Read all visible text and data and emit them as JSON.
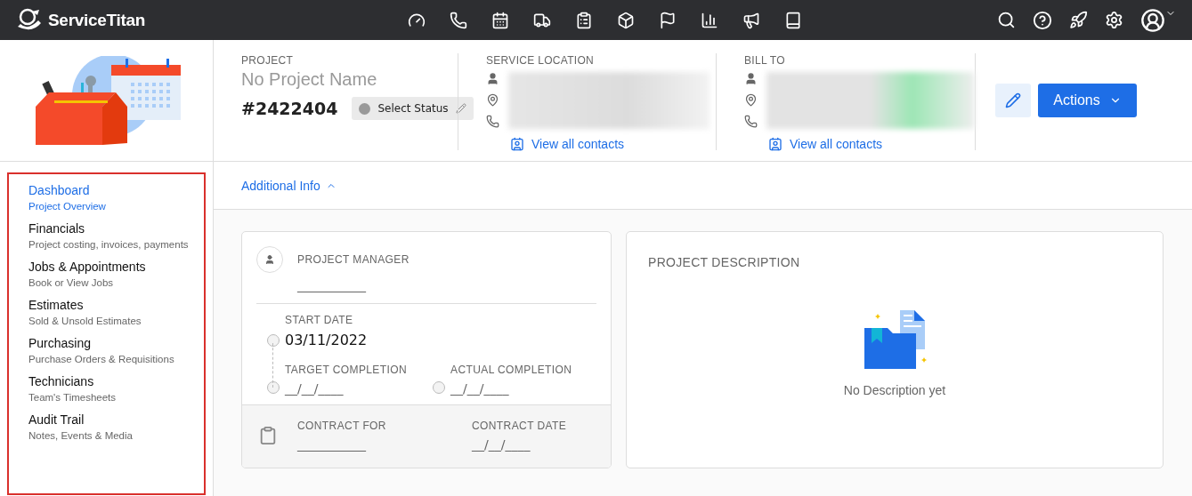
{
  "topbar": {
    "brand": "ServiceTitan"
  },
  "project": {
    "label": "PROJECT",
    "name": "No Project Name",
    "number": "#2422404",
    "status": "Select Status"
  },
  "contacts": [
    {
      "label": "SERVICE LOCATION",
      "link": "View all contacts"
    },
    {
      "label": "BILL TO",
      "link": "View all contacts"
    }
  ],
  "actions": {
    "label": "Actions"
  },
  "sidebar": {
    "highlighted": true,
    "items": [
      {
        "title": "Dashboard",
        "subtitle": "Project Overview",
        "selected": true
      },
      {
        "title": "Financials",
        "subtitle": "Project costing, invoices, payments",
        "selected": false
      },
      {
        "title": "Jobs & Appointments",
        "subtitle": "Book or View Jobs",
        "selected": false
      },
      {
        "title": "Estimates",
        "subtitle": "Sold & Unsold Estimates",
        "selected": false
      },
      {
        "title": "Purchasing",
        "subtitle": "Purchase Orders & Requisitions",
        "selected": false
      },
      {
        "title": "Technicians",
        "subtitle": "Team's Timesheets",
        "selected": false
      },
      {
        "title": "Audit Trail",
        "subtitle": "Notes, Events & Media",
        "selected": false
      }
    ]
  },
  "additional_info": {
    "label": "Additional Info",
    "expanded": true
  },
  "details": {
    "manager": {
      "label": "PROJECT MANAGER",
      "value": "___________"
    },
    "start": {
      "label": "START DATE",
      "value": "03/11/2022"
    },
    "target": {
      "label": "TARGET COMPLETION",
      "value": "__/__/____"
    },
    "actual": {
      "label": "ACTUAL COMPLETION",
      "value": "__/__/____"
    },
    "contract_for": {
      "label": "CONTRACT FOR",
      "value": "___________"
    },
    "contract_date": {
      "label": "CONTRACT DATE",
      "value": "__/__/____"
    }
  },
  "description": {
    "title": "PROJECT DESCRIPTION",
    "empty_text": "No Description yet"
  }
}
